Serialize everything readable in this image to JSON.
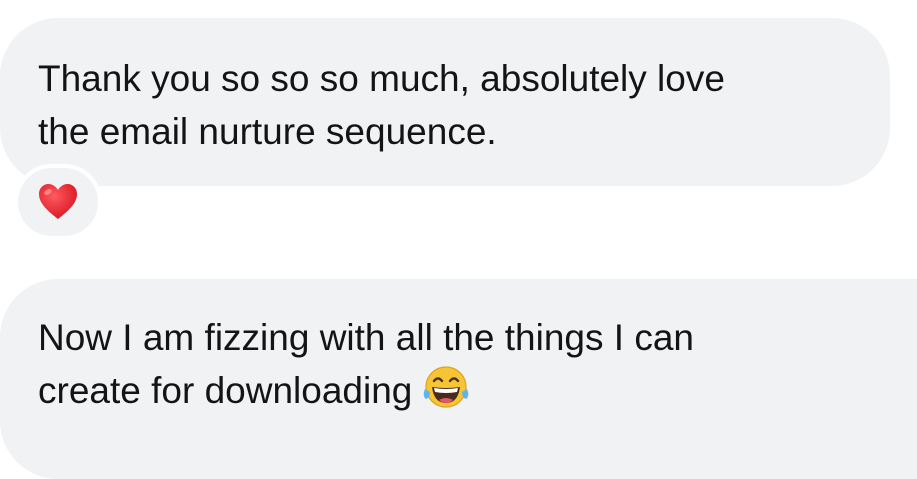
{
  "messages": [
    {
      "lines": [
        "Thank you so so so much, absolutely love",
        "the email nurture sequence."
      ],
      "reaction": "heart-icon"
    },
    {
      "lines": [
        "Now I am fizzing with all the things I can",
        "create for downloading"
      ],
      "trailing_emoji": "laughing-tears-icon"
    }
  ],
  "colors": {
    "bubble": "#f1f2f4",
    "text": "#141414",
    "heart": "#e0242f",
    "emoji_face": "#f7c435"
  }
}
